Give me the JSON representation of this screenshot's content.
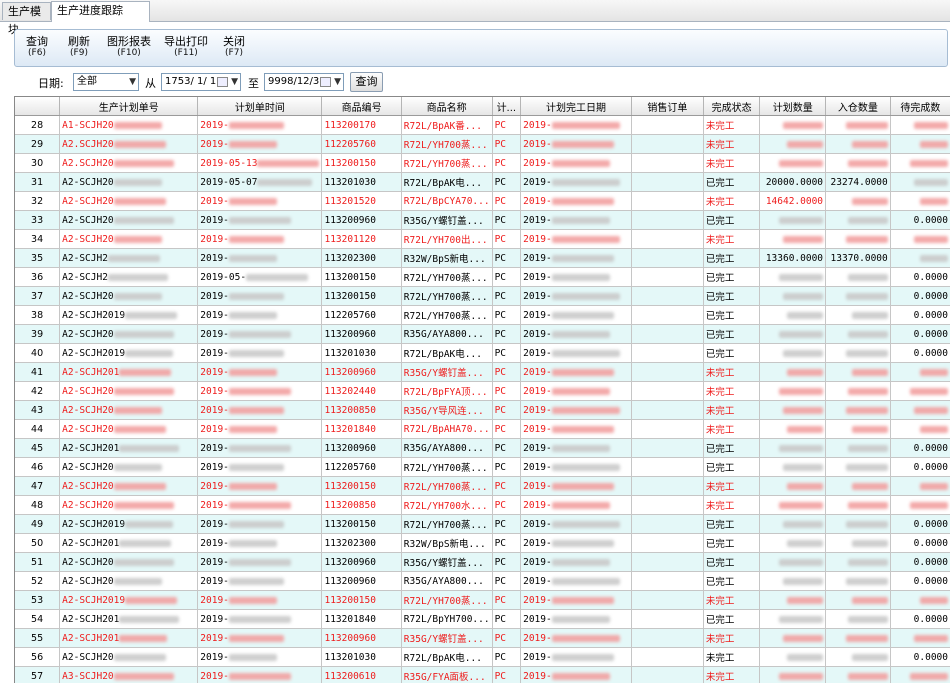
{
  "tabs": [
    {
      "label": "生产模块"
    },
    {
      "label": "生产进度跟踪"
    }
  ],
  "toolbar": [
    {
      "label": "查询",
      "key": "(F6)"
    },
    {
      "label": "刷新",
      "key": "(F9)"
    },
    {
      "label": "图形报表",
      "key": "(F10)"
    },
    {
      "label": "导出打印",
      "key": "(F11)"
    },
    {
      "label": "关闭",
      "key": "(F7)"
    }
  ],
  "filter": {
    "date_label": "日期:",
    "range_value": "全部",
    "from_label": "从",
    "from_date": "1753/ 1/ 1",
    "to_label": "至",
    "to_date": "9998/12/31",
    "query_button": "查询"
  },
  "colors": {
    "red_text": "#ee1c1c",
    "alt_row": "#e4f8f8"
  },
  "table": {
    "columns": [
      "",
      "生产计划单号",
      "计划单时间",
      "商品编号",
      "商品名称",
      "计...",
      "计划完工日期",
      "销售订单",
      "完成状态",
      "计划数量",
      "入仓数量",
      "待完成数"
    ],
    "rows": [
      {
        "n": "28",
        "plan": "A1-SCJH20",
        "time": "2019-",
        "code": "113200170",
        "name": "R72L/BpAK番...",
        "unit": "PC",
        "finish": "2019-",
        "status": "未完工",
        "qty": "",
        "inq": "",
        "rest": "",
        "red": true,
        "alt": false
      },
      {
        "n": "29",
        "plan": "A2.SCJH20",
        "time": "2019-",
        "code": "112205760",
        "name": "R72L/YH700蒸...",
        "unit": "PC",
        "finish": "2019-",
        "status": "未完工",
        "qty": "",
        "inq": "",
        "rest": "",
        "red": true,
        "alt": true
      },
      {
        "n": "30",
        "plan": "A2.SCJH20",
        "time": "2019-05-13",
        "code": "113200150",
        "name": "R72L/YH700蒸...",
        "unit": "PC",
        "finish": "2019-",
        "status": "未完工",
        "qty": "",
        "inq": "",
        "rest": "",
        "red": true,
        "alt": false
      },
      {
        "n": "31",
        "plan": "A2-SCJH20",
        "time": "2019-05-07",
        "code": "113201030",
        "name": "R72L/BpAK电...",
        "unit": "PC",
        "finish": "2019-",
        "status": "已完工",
        "qty": "20000.0000",
        "inq": "23274.0000",
        "rest": "",
        "red": false,
        "alt": true
      },
      {
        "n": "32",
        "plan": "A2-SCJH20",
        "time": "2019-",
        "code": "113201520",
        "name": "R72L/BpCYA70...",
        "unit": "PC",
        "finish": "2019-",
        "status": "未完工",
        "qty": "14642.0000",
        "inq": "",
        "rest": "",
        "red": true,
        "alt": false
      },
      {
        "n": "33",
        "plan": "A2-SCJH20",
        "time": "2019-",
        "code": "113200960",
        "name": "R35G/Y螺钉盖...",
        "unit": "PC",
        "finish": "2019-",
        "status": "已完工",
        "qty": "",
        "inq": "",
        "rest": "0.0000",
        "red": false,
        "alt": true
      },
      {
        "n": "34",
        "plan": "A2-SCJH20",
        "time": "2019-",
        "code": "113201120",
        "name": "R72L/YH700出...",
        "unit": "PC",
        "finish": "2019-",
        "status": "未完工",
        "qty": "",
        "inq": "",
        "rest": "",
        "red": true,
        "alt": false
      },
      {
        "n": "35",
        "plan": "A2-SCJH2",
        "time": "2019-",
        "code": "113202300",
        "name": "R32W/BpS新电...",
        "unit": "PC",
        "finish": "2019-",
        "status": "已完工",
        "qty": "13360.0000",
        "inq": "13370.0000",
        "rest": "",
        "red": false,
        "alt": true
      },
      {
        "n": "36",
        "plan": "A2-SCJH2",
        "time": "2019-05-",
        "code": "113200150",
        "name": "R72L/YH700蒸...",
        "unit": "PC",
        "finish": "2019-",
        "status": "已完工",
        "qty": "",
        "inq": "",
        "rest": "0.0000",
        "red": false,
        "alt": false
      },
      {
        "n": "37",
        "plan": "A2-SCJH20",
        "time": "2019-",
        "code": "113200150",
        "name": "R72L/YH700蒸...",
        "unit": "PC",
        "finish": "2019-",
        "status": "已完工",
        "qty": "",
        "inq": "",
        "rest": "0.0000",
        "red": false,
        "alt": true
      },
      {
        "n": "38",
        "plan": "A2-SCJH2019",
        "time": "2019-",
        "code": "112205760",
        "name": "R72L/YH700蒸...",
        "unit": "PC",
        "finish": "2019-",
        "status": "已完工",
        "qty": "",
        "inq": "",
        "rest": "0.0000",
        "red": false,
        "alt": false
      },
      {
        "n": "39",
        "plan": "A2-SCJH20",
        "time": "2019-",
        "code": "113200960",
        "name": "R35G/AYA800...",
        "unit": "PC",
        "finish": "2019-",
        "status": "已完工",
        "qty": "",
        "inq": "",
        "rest": "0.0000",
        "red": false,
        "alt": true
      },
      {
        "n": "40",
        "plan": "A2-SCJH2019",
        "time": "2019-",
        "code": "113201030",
        "name": "R72L/BpAK电...",
        "unit": "PC",
        "finish": "2019-",
        "status": "已完工",
        "qty": "",
        "inq": "",
        "rest": "0.0000",
        "red": false,
        "alt": false
      },
      {
        "n": "41",
        "plan": "A2-SCJH201",
        "time": "2019-",
        "code": "113200960",
        "name": "R35G/Y螺钉盖...",
        "unit": "PC",
        "finish": "2019-",
        "status": "未完工",
        "qty": "",
        "inq": "",
        "rest": "",
        "red": true,
        "alt": true
      },
      {
        "n": "42",
        "plan": "A2-SCJH20",
        "time": "2019-",
        "code": "113202440",
        "name": "R72L/BpFYA顶...",
        "unit": "PC",
        "finish": "2019-",
        "status": "未完工",
        "qty": "",
        "inq": "",
        "rest": "",
        "red": true,
        "alt": false
      },
      {
        "n": "43",
        "plan": "A2-SCJH20",
        "time": "2019-",
        "code": "113200850",
        "name": "R35G/Y导风连...",
        "unit": "PC",
        "finish": "2019-",
        "status": "未完工",
        "qty": "",
        "inq": "",
        "rest": "",
        "red": true,
        "alt": true
      },
      {
        "n": "44",
        "plan": "A2-SCJH20",
        "time": "2019-",
        "code": "113201840",
        "name": "R72L/BpAHA70...",
        "unit": "PC",
        "finish": "2019-",
        "status": "未完工",
        "qty": "",
        "inq": "",
        "rest": "",
        "red": true,
        "alt": false
      },
      {
        "n": "45",
        "plan": "A2-SCJH201",
        "time": "2019-",
        "code": "113200960",
        "name": "R35G/AYA800...",
        "unit": "PC",
        "finish": "2019-",
        "status": "已完工",
        "qty": "",
        "inq": "",
        "rest": "0.0000",
        "red": false,
        "alt": true
      },
      {
        "n": "46",
        "plan": "A2-SCJH20",
        "time": "2019-",
        "code": "112205760",
        "name": "R72L/YH700蒸...",
        "unit": "PC",
        "finish": "2019-",
        "status": "已完工",
        "qty": "",
        "inq": "",
        "rest": "0.0000",
        "red": false,
        "alt": false
      },
      {
        "n": "47",
        "plan": "A2-SCJH20",
        "time": "2019-",
        "code": "113200150",
        "name": "R72L/YH700蒸...",
        "unit": "PC",
        "finish": "2019-",
        "status": "未完工",
        "qty": "",
        "inq": "",
        "rest": "",
        "red": true,
        "alt": true
      },
      {
        "n": "48",
        "plan": "A2-SCJH20",
        "time": "2019-",
        "code": "113200850",
        "name": "R72L/YH700水...",
        "unit": "PC",
        "finish": "2019-",
        "status": "未完工",
        "qty": "",
        "inq": "",
        "rest": "",
        "red": true,
        "alt": false
      },
      {
        "n": "49",
        "plan": "A2-SCJH2019",
        "time": "2019-",
        "code": "113200150",
        "name": "R72L/YH700蒸...",
        "unit": "PC",
        "finish": "2019-",
        "status": "已完工",
        "qty": "",
        "inq": "",
        "rest": "0.0000",
        "red": false,
        "alt": true
      },
      {
        "n": "50",
        "plan": "A2-SCJH201",
        "time": "2019-",
        "code": "113202300",
        "name": "R32W/BpS新电...",
        "unit": "PC",
        "finish": "2019-",
        "status": "已完工",
        "qty": "",
        "inq": "",
        "rest": "0.0000",
        "red": false,
        "alt": false
      },
      {
        "n": "51",
        "plan": "A2-SCJH20",
        "time": "2019-",
        "code": "113200960",
        "name": "R35G/Y螺钉盖...",
        "unit": "PC",
        "finish": "2019-",
        "status": "已完工",
        "qty": "",
        "inq": "",
        "rest": "0.0000",
        "red": false,
        "alt": true
      },
      {
        "n": "52",
        "plan": "A2-SCJH20",
        "time": "2019-",
        "code": "113200960",
        "name": "R35G/AYA800...",
        "unit": "PC",
        "finish": "2019-",
        "status": "已完工",
        "qty": "",
        "inq": "",
        "rest": "0.0000",
        "red": false,
        "alt": false
      },
      {
        "n": "53",
        "plan": "A2-SCJH2019",
        "time": "2019-",
        "code": "113200150",
        "name": "R72L/YH700蒸...",
        "unit": "PC",
        "finish": "2019-",
        "status": "未完工",
        "qty": "",
        "inq": "",
        "rest": "",
        "red": true,
        "alt": true
      },
      {
        "n": "54",
        "plan": "A2-SCJH201",
        "time": "2019-",
        "code": "113201840",
        "name": "R72L/BpYH700...",
        "unit": "PC",
        "finish": "2019-",
        "status": "已完工",
        "qty": "",
        "inq": "",
        "rest": "0.0000",
        "red": false,
        "alt": false
      },
      {
        "n": "55",
        "plan": "A2-SCJH201",
        "time": "2019-",
        "code": "113200960",
        "name": "R35G/Y螺钉盖...",
        "unit": "PC",
        "finish": "2019-",
        "status": "未完工",
        "qty": "",
        "inq": "",
        "rest": "",
        "red": true,
        "alt": true
      },
      {
        "n": "56",
        "plan": "A2-SCJH20",
        "time": "2019-",
        "code": "113201030",
        "name": "R72L/BpAK电...",
        "unit": "PC",
        "finish": "2019-",
        "status": "未完工",
        "qty": "",
        "inq": "",
        "rest": "0.0000",
        "red": false,
        "alt": false
      },
      {
        "n": "57",
        "plan": "A3-SCJH20",
        "time": "2019-",
        "code": "113200610",
        "name": "R35G/FYA面板...",
        "unit": "PC",
        "finish": "2019-",
        "status": "未完工",
        "qty": "",
        "inq": "",
        "rest": "",
        "red": true,
        "alt": true
      }
    ]
  }
}
